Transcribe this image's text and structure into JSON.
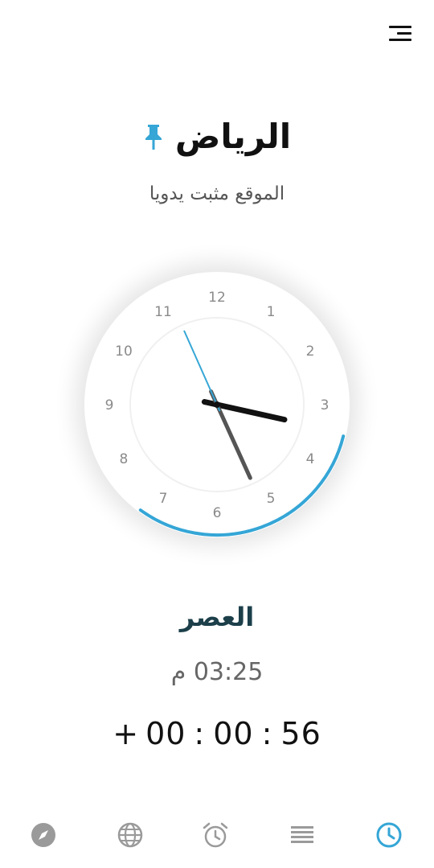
{
  "header": {
    "menu_icon": "menu-lines-icon"
  },
  "location": {
    "city": "الرياض",
    "pin_icon": "pin-icon",
    "pin_color": "#35a6d6",
    "subtitle": "الموقع مثبت يدويا"
  },
  "clock": {
    "numbers": [
      "12",
      "1",
      "2",
      "3",
      "4",
      "5",
      "6",
      "7",
      "8",
      "9",
      "10",
      "11"
    ],
    "time": {
      "hour": 3,
      "minute": 25,
      "second": 56
    },
    "accent_color": "#35a6d6",
    "arc_color": "#35a6d6"
  },
  "prayer": {
    "name": "العصر",
    "time": "03:25 م",
    "countdown": {
      "hours": "00",
      "minutes": "00",
      "seconds": "56",
      "sign": "+"
    }
  },
  "nav": {
    "items": [
      {
        "icon": "compass-icon",
        "active": false
      },
      {
        "icon": "globe-icon",
        "active": false
      },
      {
        "icon": "alarm-clock-icon",
        "active": false
      },
      {
        "icon": "list-lines-icon",
        "active": false
      },
      {
        "icon": "clock-icon",
        "active": true
      }
    ],
    "active_color": "#35a6d6",
    "inactive_color": "#9a9a9a"
  }
}
